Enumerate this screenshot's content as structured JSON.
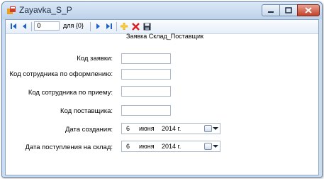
{
  "window": {
    "title": "Zayavka_S_P"
  },
  "toolbar": {
    "position": "0",
    "count": "для {0}"
  },
  "form": {
    "title": "Заявка Склад_Поставщик",
    "fields": [
      {
        "label": "Код заявки:",
        "value": ""
      },
      {
        "label": "Код сотрудника по оформлению:",
        "value": ""
      },
      {
        "label": "Код сотрудника по приему:",
        "value": ""
      },
      {
        "label": "Код поставщика:",
        "value": ""
      }
    ],
    "dates": [
      {
        "label": "Дата создания:",
        "day": "6",
        "month": "июня",
        "year": "2014 г."
      },
      {
        "label": "Дата поступления на склад:",
        "day": "6",
        "month": "июня",
        "year": "2014 г."
      }
    ]
  },
  "colors": {
    "close": "#c4422a",
    "delete": "#d81e1e",
    "navigation": "#1f5fc8",
    "add": "#f2b318"
  }
}
